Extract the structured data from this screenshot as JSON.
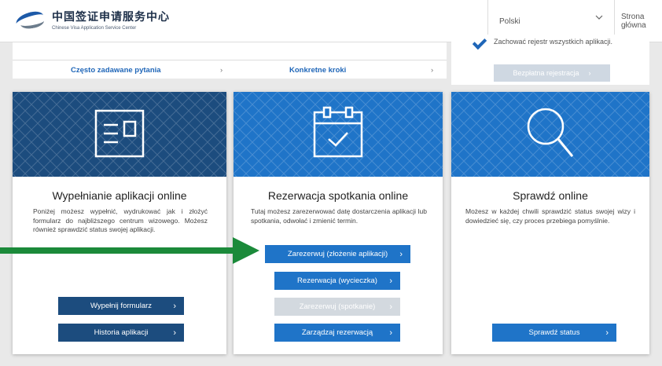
{
  "header": {
    "logo_cn": "中国签证申请服务中心",
    "logo_en": "Chinese Visa Application Service Center",
    "language": "Polski",
    "home_link": "Strona główna"
  },
  "upper": {
    "faq": "Często zadawane pytania",
    "steps": "Konkretne kroki",
    "register_note": "Zachować rejestr wszystkich aplikacji.",
    "register_button": "Bezpłatna rejestracja"
  },
  "cards": [
    {
      "title": "Wypełnianie aplikacji online",
      "description": "Poniżej możesz wypełnić, wydrukować jak i złożyć formularz do najbliższego centrum wizowego. Możesz również sprawdzić status swojej aplikacji.",
      "buttons": [
        "Wypełnij formularz",
        "Historia aplikacji"
      ]
    },
    {
      "title": "Rezerwacja spotkania online",
      "description": "Tutaj możesz zarezerwować datę dostarczenia aplikacji lub spotkania, odwołać i zmienić termin.",
      "buttons": [
        "Zarezerwuj (złożenie aplikacji)",
        "Rezerwacja (wycieczka)",
        "Zarezerwuj (spotkanie)",
        "Zarządzaj rezerwacją"
      ]
    },
    {
      "title": "Sprawdź online",
      "description": "Możesz w każdej chwili sprawdzić status swojej wizy i dowiedzieć się, czy proces przebiega pomyślnie.",
      "buttons": [
        "Sprawdź status"
      ]
    }
  ],
  "icons": {
    "card1": "application-form-icon",
    "card2": "calendar-check-icon",
    "card3": "magnifier-icon",
    "annotation": "green-arrow"
  },
  "colors": {
    "dark_blue": "#1c4c7e",
    "blue": "#1f74c8",
    "disabled": "#d3d9df",
    "arrow": "#1b8a3a"
  }
}
